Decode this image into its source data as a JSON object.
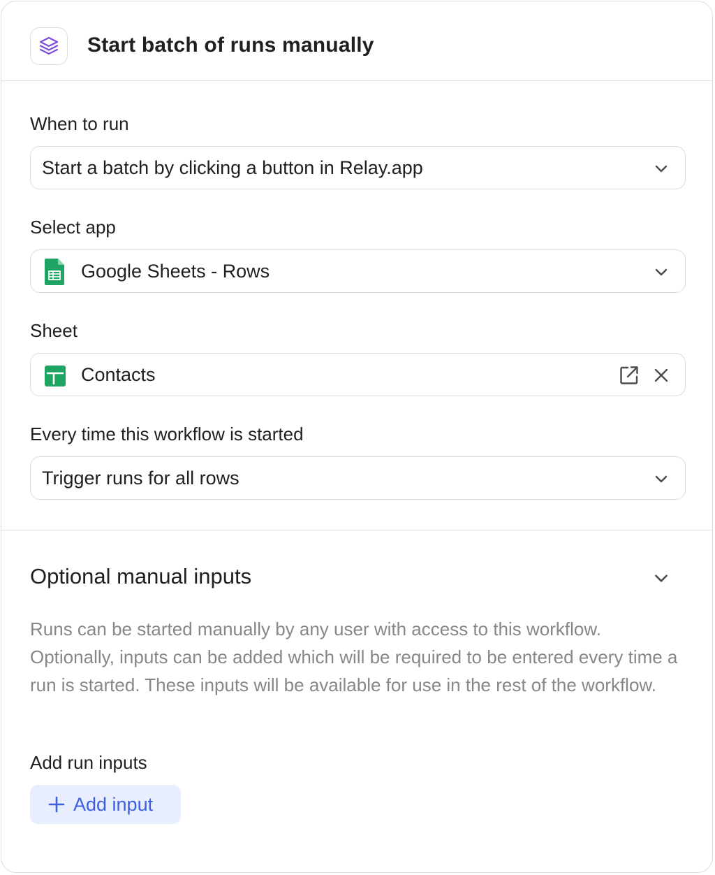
{
  "header": {
    "title": "Start batch of runs manually",
    "icon": "layers-icon",
    "accent": "#7c4ddb"
  },
  "when_to_run": {
    "label": "When to run",
    "value": "Start a batch by clicking a button in Relay.app"
  },
  "select_app": {
    "label": "Select app",
    "value": "Google Sheets - Rows",
    "icon": "google-sheets-icon"
  },
  "sheet": {
    "label": "Sheet",
    "value": "Contacts",
    "icon": "sheet-file-icon"
  },
  "every_time": {
    "label": "Every time this workflow is started",
    "value": "Trigger runs for all rows"
  },
  "optional": {
    "title": "Optional manual inputs",
    "description": "Runs can be started manually by any user with access to this workflow. Optionally, inputs can be added which will be required to be entered every time a run is started. These inputs will be available for use in the rest of the workflow.",
    "add_label": "Add run inputs",
    "add_button": "Add input"
  },
  "colors": {
    "sheets_green": "#1fa463",
    "button_bg": "#e8eefe",
    "button_text": "#3d5fe0"
  }
}
